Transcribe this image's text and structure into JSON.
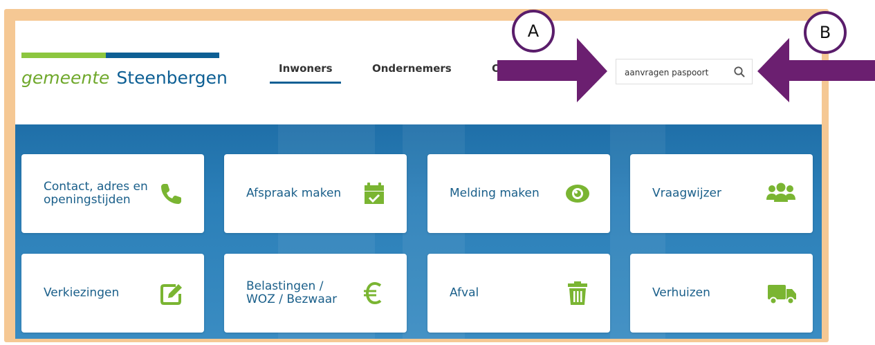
{
  "logo": {
    "part1": "gemeente",
    "part2": "Steenbergen"
  },
  "nav": {
    "items": [
      "Inwoners",
      "Ondernemers",
      "O"
    ]
  },
  "search": {
    "value": "aanvragen paspoort"
  },
  "tiles": [
    {
      "label": "Contact, adres en openingstijden",
      "icon": "phone-icon"
    },
    {
      "label": "Afspraak maken",
      "icon": "calendar-check-icon"
    },
    {
      "label": "Melding maken",
      "icon": "eye-icon"
    },
    {
      "label": "Vraagwijzer",
      "icon": "users-icon"
    },
    {
      "label": "Verkiezingen",
      "icon": "edit-icon"
    },
    {
      "label": "Belastingen / WOZ / Bezwaar",
      "icon": "euro-icon"
    },
    {
      "label": "Afval",
      "icon": "trash-icon"
    },
    {
      "label": "Verhuizen",
      "icon": "truck-icon"
    }
  ],
  "annotations": {
    "a": "A",
    "b": "B"
  },
  "colors": {
    "brand_blue": "#0d5f94",
    "brand_green": "#8cc63f",
    "arrow": "#6b1f70",
    "frame": "#f5c894"
  }
}
